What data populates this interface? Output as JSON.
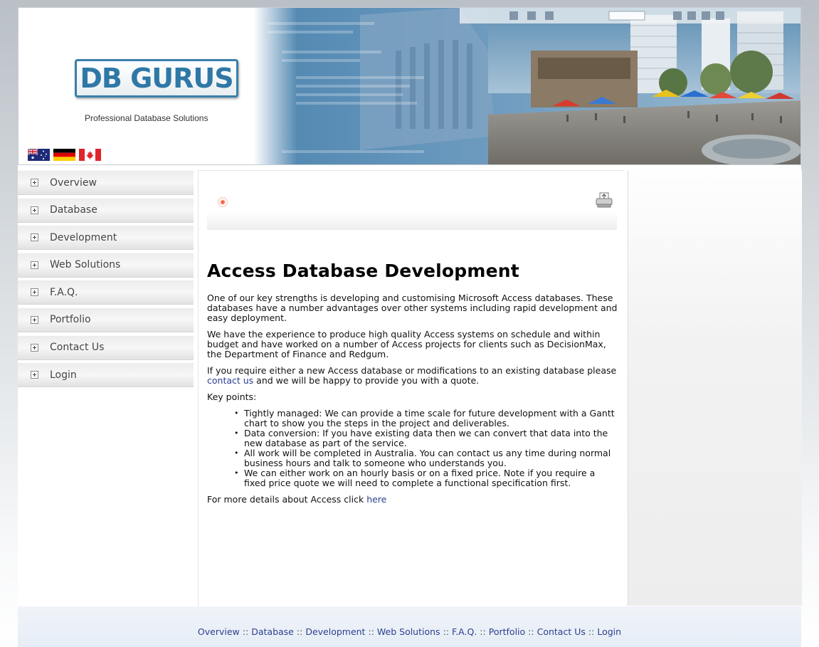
{
  "header": {
    "logo_text": "DB GURUS",
    "tagline": "Professional Database Solutions",
    "flags": [
      "australia-flag-icon",
      "germany-flag-icon",
      "canada-flag-icon"
    ]
  },
  "sidebar": {
    "items": [
      {
        "label": "Overview"
      },
      {
        "label": "Database"
      },
      {
        "label": "Development"
      },
      {
        "label": "Web Solutions"
      },
      {
        "label": "F.A.Q."
      },
      {
        "label": "Portfolio"
      },
      {
        "label": "Contact Us"
      },
      {
        "label": "Login"
      }
    ]
  },
  "toolbar": {
    "pdf_icon": "pdf-icon",
    "print_icon": "print-icon"
  },
  "article": {
    "title": "Access Database Development",
    "para1": "One of our key strengths is developing and customising Microsoft Access databases. These databases have a number advantages over other systems including rapid development and easy deployment.",
    "para2": "We have the experience to produce high quality Access systems on schedule and within budget and have worked on a number of Access projects for clients such as DecisionMax, the Department of Finance and Redgum.",
    "para3_before": "If you require either a new Access database or modifications to an existing database please ",
    "para3_link": "contact us",
    "para3_after": " and we will be happy to provide you with a quote.",
    "key_points_label": "Key points:",
    "key_points": [
      "Tightly managed: We can provide a time scale for future development with a Gantt chart to show you the steps in the project and deliverables.",
      "Data conversion: If you have existing data then we can convert that data into the new database as part of the service.",
      "All work will be completed in Australia. You can contact us any time during normal business hours and talk to someone who understands you.",
      "We can either work on an hourly basis or on a fixed price. Note if you require a fixed price quote we will need to complete a functional specification first."
    ],
    "more_before": "For more details about Access click ",
    "more_link": "here"
  },
  "footer": {
    "separator": "::",
    "links": [
      "Overview",
      "Database",
      "Development",
      "Web Solutions",
      "F.A.Q.",
      "Portfolio",
      "Contact Us",
      "Login"
    ]
  },
  "colors": {
    "link": "#2b3f8f",
    "logo_accent": "#2f78a6"
  }
}
